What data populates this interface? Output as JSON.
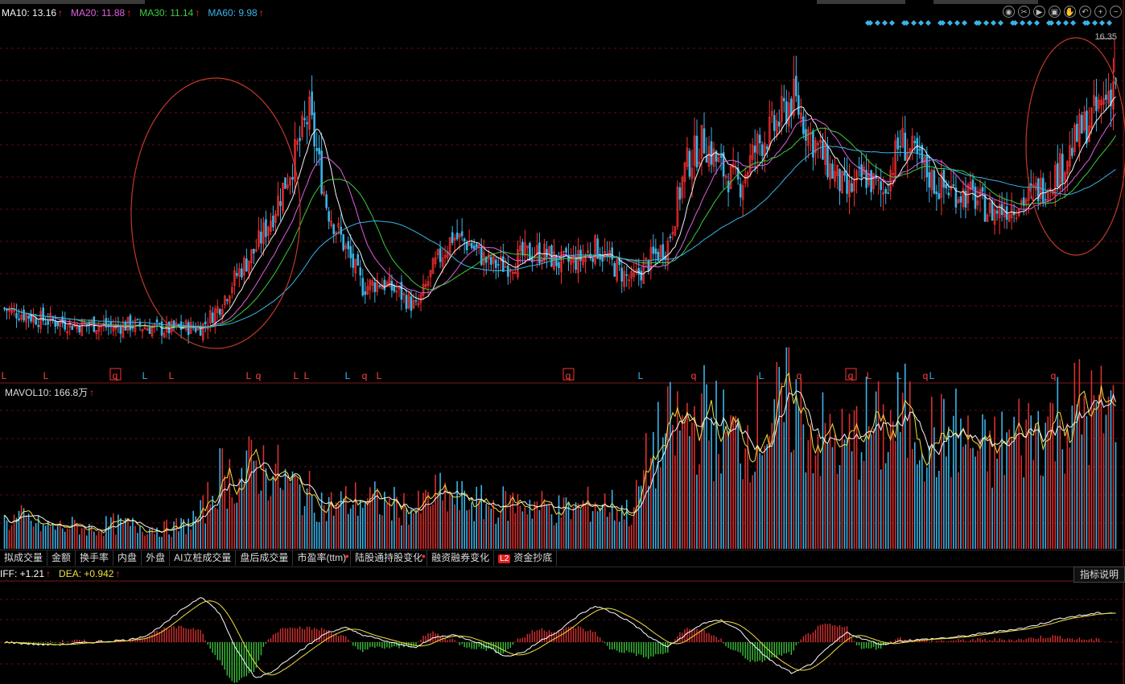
{
  "indicators": {
    "ma": [
      {
        "label": "MA10: 13.16",
        "color": "#f4f4f4"
      },
      {
        "label": "MA20: 11.88",
        "color": "#e060e0"
      },
      {
        "label": "MA30: 11.14",
        "color": "#3dcc3d"
      },
      {
        "label": "MA60: 9.98",
        "color": "#3ab4e8"
      }
    ],
    "mavol": "MAVOL10: 166.8万",
    "macd": [
      {
        "label": "IFF: +1.21",
        "color": "#ffffff"
      },
      {
        "label": "DEA: +0.942",
        "color": "#f0e040"
      }
    ]
  },
  "price_high_label": "16.35",
  "signal_marks": [
    {
      "text": "L",
      "color": "#ff4040",
      "box": false
    },
    {
      "text": "L",
      "color": "#ff4040",
      "box": false
    },
    {
      "text": "q",
      "color": "#ff4040",
      "box": true
    },
    {
      "text": "L",
      "color": "#3ab4e8",
      "box": false
    },
    {
      "text": "L",
      "color": "#ff4040",
      "box": false
    },
    {
      "text": "L",
      "color": "#ff4040",
      "box": false
    },
    {
      "text": "q",
      "color": "#ff4040",
      "box": false
    },
    {
      "text": "L",
      "color": "#ff4040",
      "box": false
    },
    {
      "text": "L",
      "color": "#ff4040",
      "box": false
    },
    {
      "text": "L",
      "color": "#3ab4e8",
      "box": false
    },
    {
      "text": "q",
      "color": "#ff4040",
      "box": false
    },
    {
      "text": "L",
      "color": "#ff4040",
      "box": false
    },
    {
      "text": "q",
      "color": "#ff4040",
      "box": true
    },
    {
      "text": "L",
      "color": "#3ab4e8",
      "box": false
    },
    {
      "text": "q",
      "color": "#ff4040",
      "box": false
    },
    {
      "text": "L",
      "color": "#3ab4e8",
      "box": false
    },
    {
      "text": "q",
      "color": "#ff4040",
      "box": false
    },
    {
      "text": "q",
      "color": "#ff4040",
      "box": true
    },
    {
      "text": "L",
      "color": "#ff4040",
      "box": false
    },
    {
      "text": "L",
      "color": "#3ab4e8",
      "box": false
    },
    {
      "text": "q",
      "color": "#ff4040",
      "box": false
    },
    {
      "text": "L",
      "color": "#3ab4e8",
      "box": false
    },
    {
      "text": "q",
      "color": "#ff4040",
      "box": false
    }
  ],
  "tabs": [
    {
      "label": "拟成交量",
      "dot": false
    },
    {
      "label": "金额",
      "dot": false
    },
    {
      "label": "换手率",
      "dot": false
    },
    {
      "label": "内盘",
      "dot": false
    },
    {
      "label": "外盘",
      "dot": false
    },
    {
      "label": "AI立桩成交量",
      "dot": false
    },
    {
      "label": "盘后成交量",
      "dot": false
    },
    {
      "label": "市盈率(ttm)",
      "dot": true
    },
    {
      "label": "陆股通持股变化",
      "dot": true
    },
    {
      "label": "融资融券变化",
      "dot": false
    },
    {
      "label": "资金抄底",
      "dot": false,
      "badge": "L2"
    }
  ],
  "explain_button": "指标说明",
  "tool_icons": [
    "eye-icon",
    "scissors-icon",
    "play-icon",
    "lock-icon",
    "hand-icon",
    "undo-icon",
    "zoom-in-icon",
    "zoom-out-icon"
  ],
  "chart_data": {
    "type": "candlestick",
    "ma_series": [
      "MA10",
      "MA20",
      "MA30",
      "MA60"
    ],
    "last_values": {
      "MA10": 13.16,
      "MA20": 11.88,
      "MA30": 11.14,
      "MA60": 9.98
    },
    "high": 16.35,
    "close_profile": [
      6.2,
      6.0,
      5.8,
      5.7,
      5.6,
      5.6,
      5.5,
      5.6,
      5.5,
      5.4,
      5.5,
      5.5,
      6.3,
      7.5,
      8.4,
      9.8,
      11.5,
      13.5,
      10.0,
      8.5,
      7.0,
      7.2,
      6.8,
      6.2,
      7.8,
      8.9,
      8.6,
      7.9,
      7.8,
      8.2,
      8.3,
      7.9,
      8.0,
      8.5,
      7.8,
      7.2,
      8.0,
      8.6,
      11.5,
      12.5,
      11.4,
      10.8,
      12.3,
      13.0,
      14.1,
      12.6,
      11.5,
      10.5,
      11.2,
      10.5,
      12.5,
      11.7,
      10.8,
      10.6,
      10.4,
      9.8,
      10.0,
      10.3,
      10.8,
      11.5,
      12.8,
      13.6,
      14.8
    ],
    "volume_profile": [
      35,
      40,
      30,
      28,
      30,
      25,
      32,
      30,
      28,
      26,
      30,
      45,
      95,
      90,
      110,
      100,
      80,
      70,
      55,
      60,
      65,
      60,
      55,
      50,
      70,
      65,
      60,
      55,
      58,
      60,
      55,
      50,
      52,
      60,
      55,
      45,
      120,
      150,
      160,
      170,
      150,
      140,
      160,
      170,
      190,
      150,
      140,
      130,
      160,
      150,
      170,
      160,
      140,
      150,
      130,
      120,
      140,
      150,
      160,
      170,
      180,
      170,
      175
    ],
    "macd": {
      "diff_profile": [
        0,
        -0.05,
        -0.1,
        -0.1,
        -0.05,
        0,
        0.05,
        0.1,
        0.3,
        0.8,
        1.4,
        1.9,
        1.2,
        -0.4,
        -1.5,
        -1.2,
        -0.6,
        -0.1,
        0.4,
        0.6,
        0.3,
        0.1,
        -0.1,
        -0.2,
        0.2,
        0.3,
        0.1,
        -0.2,
        -0.6,
        -0.4,
        0.1,
        0.5,
        1.1,
        1.5,
        1.2,
        0.8,
        0.2,
        -0.2,
        0.3,
        0.8,
        0.9,
        0.5,
        -0.3,
        -0.9,
        -1.3,
        -0.9,
        -0.2,
        0.4,
        0.1,
        -0.1,
        0.05,
        0.1,
        0.15,
        0.2,
        0.3,
        0.4,
        0.5,
        0.6,
        0.8,
        1.0,
        1.1,
        1.2,
        1.21
      ],
      "last": {
        "DIFF": 1.21,
        "DEA": 0.942
      }
    }
  }
}
